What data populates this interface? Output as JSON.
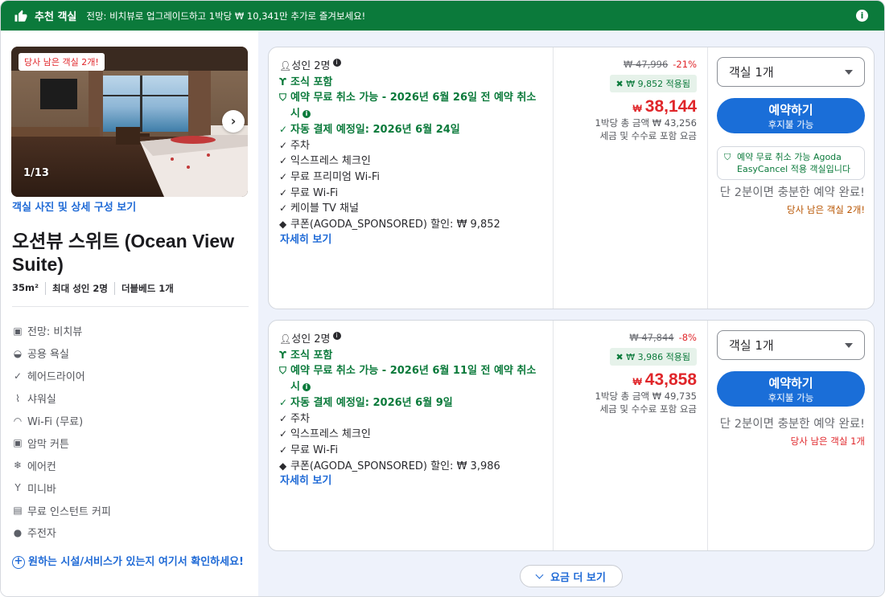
{
  "banner": {
    "title": "추천 객실",
    "text": "전망: 비치뷰로 업그레이드하고 1박당 ₩ 10,341만 추가로 즐겨보세요!"
  },
  "room": {
    "scarcity_badge": "당사 남은 객실 2개!",
    "photo_counter": "1/13",
    "photo_link": "객실 사진 및 상세 구성 보기",
    "name": "오션뷰 스위트 (Ocean View Suite)",
    "specs": [
      "35m²",
      "최대 성인 2명",
      "더블베드 1개"
    ],
    "amenities": [
      {
        "icon": "view-icon",
        "glyph": "▣",
        "label": "전망: 비치뷰"
      },
      {
        "icon": "bathtub-icon",
        "glyph": "◒",
        "label": "공용 욕실"
      },
      {
        "icon": "check-icon",
        "glyph": "✓",
        "label": "헤어드라이어"
      },
      {
        "icon": "shower-icon",
        "glyph": "⌇",
        "label": "샤워실"
      },
      {
        "icon": "wifi-icon",
        "glyph": "◠",
        "label": "Wi-Fi (무료)"
      },
      {
        "icon": "blackout-curtain-icon",
        "glyph": "▣",
        "label": "암막 커튼"
      },
      {
        "icon": "snowflake-icon",
        "glyph": "❄",
        "label": "에어컨"
      },
      {
        "icon": "cocktail-icon",
        "glyph": "Y",
        "label": "미니바"
      },
      {
        "icon": "coffee-machine-icon",
        "glyph": "▤",
        "label": "무료 인스턴트 커피"
      },
      {
        "icon": "kettle-icon",
        "glyph": "●",
        "label": "주전자"
      }
    ],
    "facility_cta": "원하는 시설/서비스가 있는지 여기서 확인하세요!"
  },
  "offers": [
    {
      "guests": "성인 2명",
      "breakfast": "조식 포함",
      "free_cancel": "예약 무료 취소 가능 - 2026년 6월 26일 전 예약 취소 시",
      "auto_pay": "자동 결제 예정일: 2026년 6월 24일",
      "features": [
        "주차",
        "익스프레스 체크인",
        "무료 프리미엄 Wi-Fi",
        "무료 Wi-Fi",
        "케이블 TV 채널"
      ],
      "coupon_line": "쿠폰(AGODA_SPONSORED) 할인: ₩ 9,852",
      "details_link": "자세히 보기",
      "original_price": "₩ 47,996",
      "discount": "-21%",
      "coupon_applied": "₩ 9,852 적용됨",
      "currency": "₩",
      "price": "38,144",
      "total": "1박당 총 금액 ₩ 43,256",
      "tax_note": "세금 및 수수료 포함 요금",
      "room_select": "객실 1개",
      "book_label": "예약하기",
      "book_sub": "후지불 가능",
      "cancel_box": "예약 무료 취소 가능 Agoda EasyCancel 적용 객실입니다",
      "quick_note": "단 2분이면 충분한 예약 완료!",
      "rooms_left": "당사 남은 객실 2개!"
    },
    {
      "guests": "성인 2명",
      "breakfast": "조식 포함",
      "free_cancel": "예약 무료 취소 가능 - 2026년 6월 11일 전 예약 취소 시",
      "auto_pay": "자동 결제 예정일: 2026년 6월 9일",
      "features": [
        "주차",
        "익스프레스 체크인",
        "무료 Wi-Fi"
      ],
      "coupon_line": "쿠폰(AGODA_SPONSORED) 할인: ₩ 3,986",
      "details_link": "자세히 보기",
      "original_price": "₩ 47,844",
      "discount": "-8%",
      "coupon_applied": "₩ 3,986 적용됨",
      "currency": "₩",
      "price": "43,858",
      "total": "1박당 총 금액 ₩ 49,735",
      "tax_note": "세금 및 수수료 포함 요금",
      "room_select": "객실 1개",
      "book_label": "예약하기",
      "book_sub": "후지불 가능",
      "quick_note": "단 2분이면 충분한 예약 완료!",
      "rooms_left": "당사 남은 객실 1개"
    }
  ],
  "more_prices": "요금 더 보기",
  "colors": {
    "brand_green": "#0b7a3b",
    "book_blue": "#1a6ed8",
    "price_red": "#e0262a",
    "right_bg": "#eef2fb"
  }
}
